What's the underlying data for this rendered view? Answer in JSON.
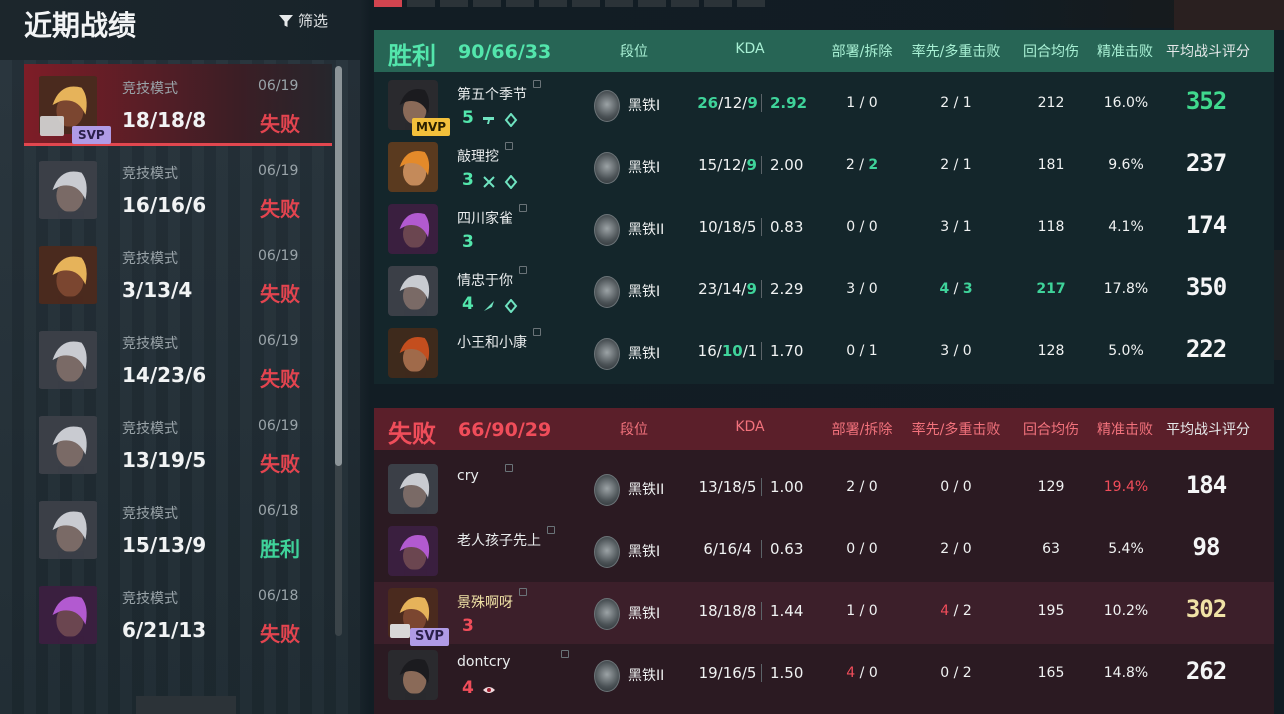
{
  "left": {
    "title": "近期战绩",
    "filter_label": "筛选",
    "matches": [
      {
        "mode": "竞技模式",
        "date": "06/19",
        "kda": "18/18/8",
        "result": "失败",
        "result_type": "lose",
        "selected": true,
        "svp": "SVP",
        "agent": "gold-dreads"
      },
      {
        "mode": "竞技模式",
        "date": "06/19",
        "kda": "16/16/6",
        "result": "失败",
        "result_type": "lose",
        "agent": "silver-hair"
      },
      {
        "mode": "竞技模式",
        "date": "06/19",
        "kda": "3/13/4",
        "result": "失败",
        "result_type": "lose",
        "agent": "gold-dreads"
      },
      {
        "mode": "竞技模式",
        "date": "06/19",
        "kda": "14/23/6",
        "result": "失败",
        "result_type": "lose",
        "agent": "silver-hair"
      },
      {
        "mode": "竞技模式",
        "date": "06/19",
        "kda": "13/19/5",
        "result": "失败",
        "result_type": "lose",
        "agent": "silver-hair"
      },
      {
        "mode": "竞技模式",
        "date": "06/18",
        "kda": "15/13/9",
        "result": "胜利",
        "result_type": "win",
        "agent": "silver-hair"
      },
      {
        "mode": "竞技模式",
        "date": "06/18",
        "kda": "6/21/13",
        "result": "失败",
        "result_type": "lose",
        "agent": "purple-hair"
      }
    ]
  },
  "headers": {
    "rank": "段位",
    "kda": "KDA",
    "plant": "部署/拆除",
    "first": "率先/多重击败",
    "adr": "回合均伤",
    "hs": "精准击败",
    "rating": "平均战斗评分"
  },
  "teams": [
    {
      "result": "胜利",
      "score": "90/66/33",
      "type": "win",
      "players": [
        {
          "name": "第五个季节",
          "agent": "dark-ponytail",
          "badge": "MVP",
          "level": "5",
          "icons": [
            "gun-icon",
            "diamond-icon"
          ],
          "rank": "黑铁I",
          "k": "26",
          "d": "12",
          "a": "9",
          "kd": "2.92",
          "plant": "1 / 0",
          "first": "2 / 1",
          "adr": "212",
          "hs": "16.0%",
          "rating": "352",
          "hl": {
            "k": true,
            "a": true,
            "kd": true,
            "rating": true
          }
        },
        {
          "name": "敲理挖",
          "agent": "orange-bun",
          "level": "3",
          "icons": [
            "crossed-swords-icon",
            "diamond-icon"
          ],
          "rank": "黑铁I",
          "k": "15",
          "d": "12",
          "a": "9",
          "kd": "2.00",
          "plant": "2 / 2",
          "first": "2 / 1",
          "adr": "181",
          "hs": "9.6%",
          "rating": "237",
          "hl": {
            "a": true,
            "plant2": true
          }
        },
        {
          "name": "四川家雀",
          "agent": "purple-hair",
          "level": "3",
          "icons": [],
          "rank": "黑铁II",
          "k": "10",
          "d": "18",
          "a": "5",
          "kd": "0.83",
          "plant": "0 / 0",
          "first": "3 / 1",
          "adr": "118",
          "hs": "4.1%",
          "rating": "174"
        },
        {
          "name": "情忠于你",
          "agent": "silver-hair",
          "level": "4",
          "icons": [
            "knife-icon",
            "diamond-icon"
          ],
          "rank": "黑铁I",
          "k": "23",
          "d": "14",
          "a": "9",
          "kd": "2.29",
          "plant": "3 / 0",
          "first_a": "4",
          "first_b": "3",
          "adr": "217",
          "hs": "17.8%",
          "rating": "350",
          "hl": {
            "a": true,
            "first": true,
            "adr": true
          }
        },
        {
          "name": "小王和小康",
          "agent": "beret",
          "level": "",
          "icons": [],
          "rank": "黑铁I",
          "k": "16",
          "d": "10",
          "a": "1",
          "kd": "1.70",
          "plant": "0 / 1",
          "first": "3 / 0",
          "adr": "128",
          "hs": "5.0%",
          "rating": "222",
          "hl": {
            "d": true
          }
        }
      ]
    },
    {
      "result": "失败",
      "score": "66/90/29",
      "type": "lose",
      "players": [
        {
          "name": "cry",
          "agent": "silver-hair",
          "level": "",
          "icons": [],
          "rank": "黑铁II",
          "k": "13",
          "d": "18",
          "a": "5",
          "kd": "1.00",
          "plant": "2 / 0",
          "first": "0 / 0",
          "adr": "129",
          "hs": "19.4%",
          "rating": "184",
          "hl": {
            "hs": true
          }
        },
        {
          "name": "老人孩子先上",
          "agent": "purple-hair",
          "level": "",
          "icons": [],
          "rank": "黑铁I",
          "k": "6",
          "d": "16",
          "a": "4",
          "kd": "0.63",
          "plant": "0 / 0",
          "first": "2 / 0",
          "adr": "63",
          "hs": "5.4%",
          "rating": "98"
        },
        {
          "name": "景殊啊呀",
          "agent": "gold-dreads",
          "badge": "SVP",
          "me": true,
          "level": "3",
          "icons": [],
          "rank": "黑铁I",
          "k": "18",
          "d": "18",
          "a": "8",
          "kd": "1.44",
          "plant": "1 / 0",
          "first_a": "4",
          "first_b": "2",
          "adr": "195",
          "hs": "10.2%",
          "rating": "302"
        },
        {
          "name": "dontcry",
          "agent": "dark-ponytail",
          "level": "4",
          "icons": [
            "eye-icon"
          ],
          "rank": "黑铁II",
          "k": "19",
          "d": "16",
          "a": "5",
          "kd": "1.50",
          "plant_a": "4",
          "plant_b": "0",
          "first": "0 / 2",
          "adr": "165",
          "hs": "14.8%",
          "rating": "262"
        }
      ]
    }
  ]
}
